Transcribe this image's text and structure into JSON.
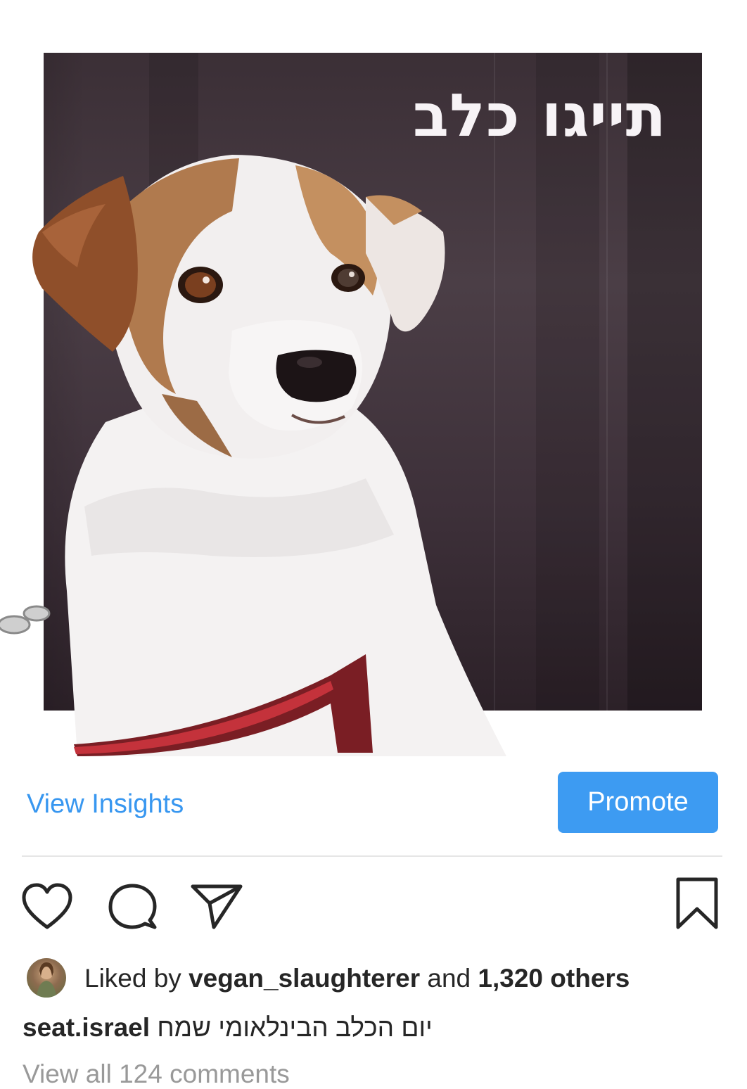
{
  "post": {
    "overlay_title": "תייגו כלב",
    "image_subject": "jack-russell-terrier-dog"
  },
  "actions": {
    "view_insights": "View Insights",
    "promote": "Promote"
  },
  "icons": {
    "like": "heart-icon",
    "comment": "comment-icon",
    "share": "send-icon",
    "save": "bookmark-icon"
  },
  "likes": {
    "prefix": "Liked by",
    "user": "vegan_slaughterer",
    "middle": "and",
    "others": "1,320 others"
  },
  "caption": {
    "username": "seat.israel",
    "text": "יום הכלב הבינלאומי שמח"
  },
  "comments": {
    "view_all": "View all 124 comments"
  },
  "colors": {
    "accent": "#3897f0",
    "promote_bg": "#3d9bf2",
    "muted_text": "#999999"
  }
}
